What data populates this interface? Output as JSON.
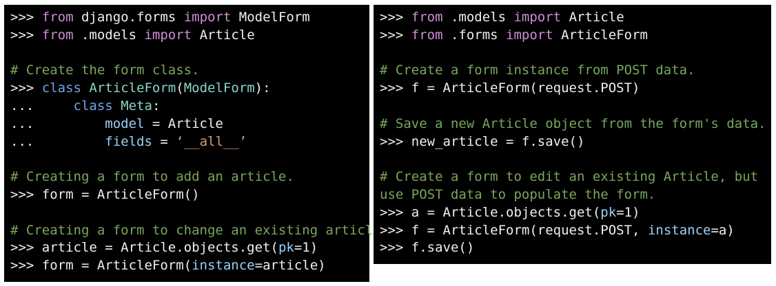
{
  "left_panel": {
    "line1": {
      "prompt": ">>> ",
      "kw1": "from",
      "mid": " django.forms ",
      "kw2": "import",
      "rest": " ModelForm"
    },
    "line2": {
      "prompt": ">>> ",
      "kw1": "from",
      "mid": " .models ",
      "kw2": "import",
      "rest": " Article"
    },
    "comment1": "# Create the form class.",
    "line4": {
      "prompt": ">>> ",
      "kw": "class",
      "sp": " ",
      "name": "ArticleForm",
      "p1": "(",
      "base": "ModelForm",
      "p2": "):"
    },
    "line5": {
      "prompt": "...     ",
      "kw": "class",
      "sp": " ",
      "name": "Meta",
      "colon": ":"
    },
    "line6": {
      "prompt": "...         ",
      "attr": "model",
      "rest": " = Article"
    },
    "line7": {
      "prompt": "...         ",
      "attr": "fields",
      "eq": " = ",
      "str": "‘__all__’"
    },
    "comment2": "# Creating a form to add an article.",
    "line9": ">>> form = ArticleForm()",
    "comment3": "# Creating a form to change an existing article.",
    "line11": {
      "pre": ">>> article = Article.objects.get(",
      "kw": "pk",
      "post": "=1)"
    },
    "line12": {
      "pre": ">>> form = ArticleForm(",
      "kw": "instance",
      "post": "=article)"
    }
  },
  "right_panel": {
    "line1": {
      "prompt": ">>> ",
      "kw1": "from",
      "mid": " .models ",
      "kw2": "import",
      "rest": " Article"
    },
    "line2": {
      "prompt": ">>> ",
      "kw1": "from",
      "mid": " .forms ",
      "kw2": "import",
      "rest": " ArticleForm"
    },
    "comment1": "# Create a form instance from POST data.",
    "line4": ">>> f = ArticleForm(request.POST)",
    "comment2": "# Save a new Article object from the form's data.",
    "line6": ">>> new_article = f.save()",
    "comment3a": "# Create a form to edit an existing Article, but",
    "comment3b": "use POST data to populate the form.",
    "line9": {
      "pre": ">>> a = Article.objects.get(",
      "kw": "pk",
      "post": "=1)"
    },
    "line10": {
      "pre": ">>> f = ArticleForm(request.POST, ",
      "kw": "instance",
      "post": "=a)"
    },
    "line11": ">>> f.save()"
  }
}
